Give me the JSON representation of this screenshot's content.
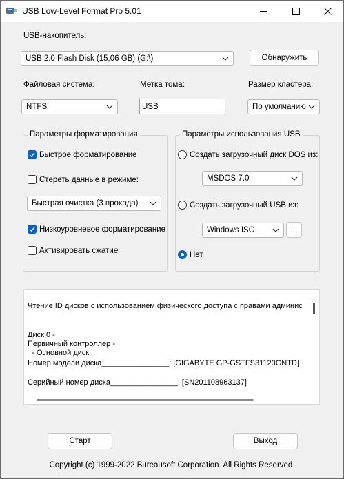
{
  "window": {
    "title": "USB Low-Level Format Pro 5.01"
  },
  "drive": {
    "label": "USB-накопитель:",
    "selected": "USB 2.0 Flash Disk (15,06 GB) (G:\\)",
    "detect_button": "Обнаружить"
  },
  "filesystem": {
    "label": "Файловая система:",
    "selected": "NTFS"
  },
  "volume": {
    "label": "Метка тома:",
    "value": "USB"
  },
  "cluster": {
    "label": "Размер кластера:",
    "selected": "По умолчанию"
  },
  "format_params": {
    "title": "Параметры форматирования",
    "quick_format": {
      "label": "Быстрое форматирование",
      "checked": true
    },
    "erase_data": {
      "label": "Стереть данные в режиме:",
      "checked": false
    },
    "erase_mode": "Быстрая очистка (3 прохода)",
    "low_level": {
      "label": "Низкоуровневое форматирование",
      "checked": true
    },
    "compression": {
      "label": "Активировать сжатие",
      "checked": false
    }
  },
  "usb_params": {
    "title": "Параметры использования USB",
    "dos_boot": {
      "label": "Создать загрузочный диск DOS из:",
      "selected": false
    },
    "dos_version": "MSDOS 7.0",
    "usb_boot": {
      "label": "Создать загрузочный USB из:",
      "selected": false
    },
    "iso_source": "Windows ISO",
    "browse_button": "...",
    "none": {
      "label": "Нет",
      "selected": true
    }
  },
  "log": {
    "lines": [
      "Чтение ID дисков с использованием физического доступа с правами админис",
      "",
      "Диск 0 -",
      "Первичный контроллер -",
      "  - Основной диск",
      "Номер модели диска________________: [GIGABYTE GP-GSTFS31120GNTD]",
      "",
      "Серийный номер диска________________: [SN201108963137]"
    ]
  },
  "buttons": {
    "start": "Старт",
    "exit": "Выход"
  },
  "footer": {
    "copyright": "Copyright (c) 1999-2022 Bureausoft Corporation. All Rights Reserved."
  },
  "colors": {
    "accent": "#0a5ec4",
    "background": "#f0f0f0"
  }
}
